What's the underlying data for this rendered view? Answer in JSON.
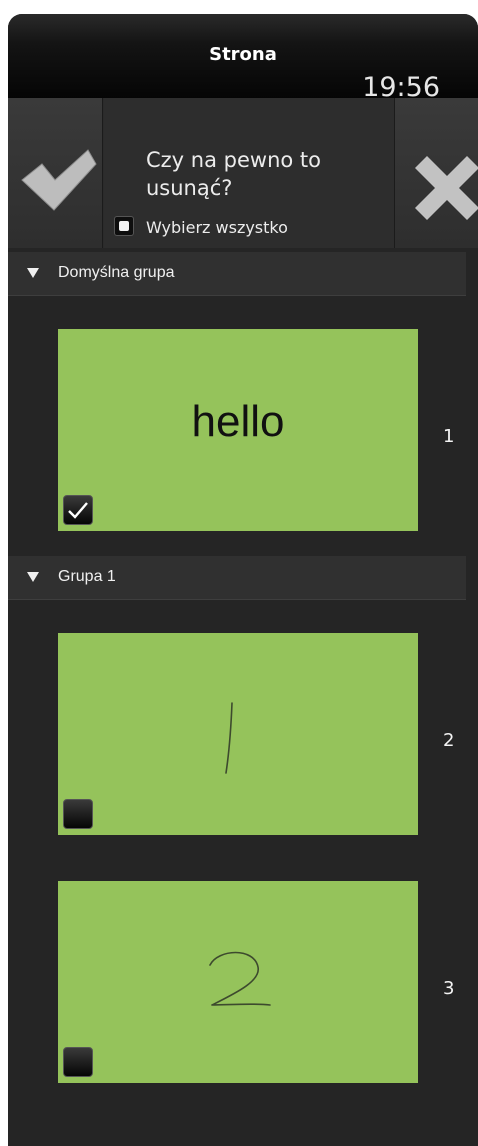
{
  "titlebar": {
    "title": "Strona",
    "clock": "19:56"
  },
  "confirm_bar": {
    "message": "Czy na pewno to usunąć?",
    "select_all_label": "Wybierz wszystko",
    "select_all_checked": false
  },
  "groups": [
    {
      "label": "Domyślna grupa"
    },
    {
      "label": "Grupa 1"
    }
  ],
  "pages": [
    {
      "number": "1",
      "content_text": "hello",
      "checked": true
    },
    {
      "number": "2",
      "checked": false
    },
    {
      "number": "3",
      "checked": false
    }
  ],
  "colors": {
    "page_bg": "#95c35b",
    "app_bg": "#252525"
  }
}
